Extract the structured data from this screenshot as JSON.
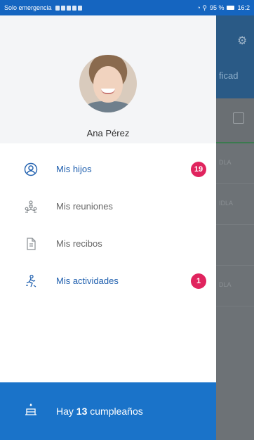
{
  "status_bar": {
    "carrier": "Solo emergencia",
    "battery": "95 %",
    "time": "16:2"
  },
  "background_app": {
    "title_fragment": "ficad",
    "row_texts": [
      "DLA",
      "IDLA",
      "DLA"
    ]
  },
  "drawer": {
    "user": {
      "name": "Ana Pérez"
    },
    "menu": [
      {
        "label": "Mis hijos",
        "icon": "person-circle-icon",
        "badge": "19",
        "active": true
      },
      {
        "label": "Mis reuniones",
        "icon": "group-icon",
        "badge": null,
        "active": false
      },
      {
        "label": "Mis recibos",
        "icon": "receipt-icon",
        "badge": null,
        "active": false
      },
      {
        "label": "Mis actividades",
        "icon": "activity-icon",
        "badge": "1",
        "active": true
      }
    ],
    "footer": {
      "prefix": "Hay",
      "count": "13",
      "suffix": "cumpleaños",
      "icon": "cake-icon"
    }
  },
  "colors": {
    "primary": "#1a73c9",
    "active_text": "#1f5fae",
    "badge": "#e0245e"
  }
}
